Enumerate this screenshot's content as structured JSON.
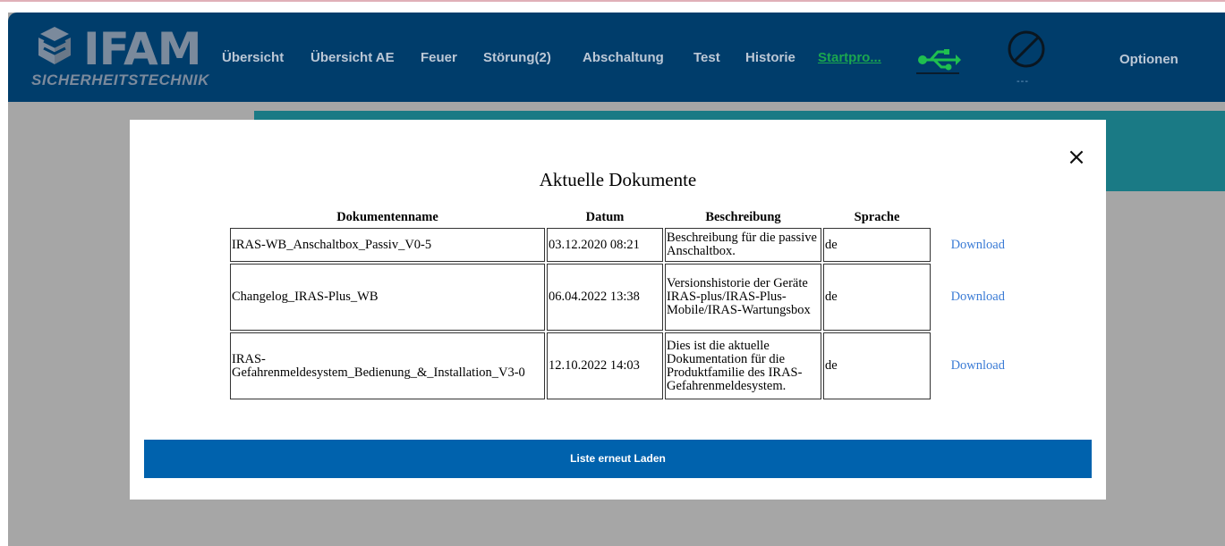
{
  "brand": {
    "word": "IFAM",
    "tagline": "SICHERHEITSTECHNIK"
  },
  "nav": [
    {
      "label": "Übersicht"
    },
    {
      "label": "Übersicht AE"
    },
    {
      "label": "Feuer"
    },
    {
      "label": "Störung(2)"
    },
    {
      "label": "Abschaltung"
    },
    {
      "label": "Test"
    },
    {
      "label": "Historie"
    },
    {
      "label": "Startpro..."
    }
  ],
  "status": {
    "ban_sub": "---"
  },
  "options_label": "Optionen",
  "colors": {
    "header": "#003d6b",
    "accent_green": "#1aa64f",
    "button_blue": "#0062ad",
    "teal": "#1a7a85"
  },
  "modal": {
    "title": "Aktuelle Dokumente",
    "close_icon": "×",
    "columns": [
      "Dokumentenname",
      "Datum",
      "Beschreibung",
      "Sprache"
    ],
    "rows": [
      {
        "name": "IRAS-WB_Anschaltbox_Passiv_V0-5",
        "date": "03.12.2020 08:21",
        "desc": "Beschreibung für die passive Anschaltbox.",
        "lang": "de",
        "action": "Download"
      },
      {
        "name": "Changelog_IRAS-Plus_WB",
        "date": "06.04.2022 13:38",
        "desc": "Versionshistorie der Geräte IRAS-plus/IRAS-Plus-Mobile/IRAS-Wartungsbox",
        "lang": "de",
        "action": "Download"
      },
      {
        "name": "IRAS-Gefahrenmeldesystem_Bedienung_&_Installation_V3-0",
        "date": "12.10.2022 14:03",
        "desc": "Dies ist die aktuelle Dokumentation für die Produktfamilie des IRAS-Gefahrenmeldesystem.",
        "lang": "de",
        "action": "Download"
      }
    ],
    "reload_label": "Liste erneut Laden"
  }
}
